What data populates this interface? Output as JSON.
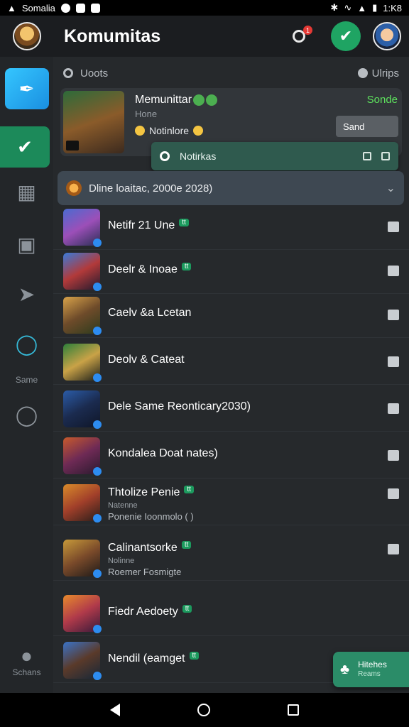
{
  "status_bar": {
    "carrier": "Somalia",
    "time": "1:K8"
  },
  "header": {
    "title": "Komumitas",
    "bell_badge": "1"
  },
  "sidebar": {
    "items": [
      {
        "icon": "brush-icon"
      },
      {
        "icon": "check-icon"
      },
      {
        "icon": "chart-icon"
      },
      {
        "icon": "calendar-icon"
      },
      {
        "icon": "pin-icon"
      },
      {
        "icon": "circle-icon"
      },
      {
        "icon": "search-icon"
      }
    ],
    "label_mid": "Same",
    "label_bottom": "Schans"
  },
  "subheader": {
    "left": "Uoots",
    "right": "Ulrips"
  },
  "featured": {
    "name": "Memunittar",
    "subtitle": "Hone",
    "notification": "Notinlore",
    "status": "Sonde",
    "send_button": "Sand"
  },
  "notif_bar": {
    "label": "Notirkas"
  },
  "dropdown": {
    "label": "Dline loaitac, 2000e 2028)"
  },
  "rows": [
    {
      "title": "Netifr 21 Une",
      "tag": "tt",
      "sub1": "",
      "sub2": ""
    },
    {
      "title": "Deelr & Inoae",
      "tag": "tt",
      "sub1": "",
      "sub2": ""
    },
    {
      "title": "Caelv &a Lcetan",
      "tag": "",
      "sub1": "",
      "sub2": ""
    },
    {
      "title": "Deolv & Cateat",
      "tag": "",
      "sub1": "",
      "sub2": ""
    },
    {
      "title": "Dele Same Reonticary2030)",
      "tag": "",
      "sub1": "",
      "sub2": ""
    },
    {
      "title": "Kondalea Doat nates)",
      "tag": "",
      "sub1": "",
      "sub2": ""
    },
    {
      "title": "Thtolize Penie",
      "tag": "tt",
      "sub1": "Natenne",
      "sub2": "Ponenie Ioonmolo (  )"
    },
    {
      "title": "Calinantsorke",
      "tag": "tt",
      "sub1": "Nolinne",
      "sub2": "Roemer Fosmigte"
    },
    {
      "title": "Fiedr Aedoety",
      "tag": "tt",
      "sub1": "",
      "sub2": ""
    },
    {
      "title": "Nendil (eamget",
      "tag": "tt",
      "sub1": "",
      "sub2": ""
    }
  ],
  "fab_card": {
    "title": "Hitehes",
    "subtitle": "Reams"
  },
  "colors": {
    "accent": "#1fa463",
    "bg": "#26292c",
    "sidebar": "#232629"
  }
}
